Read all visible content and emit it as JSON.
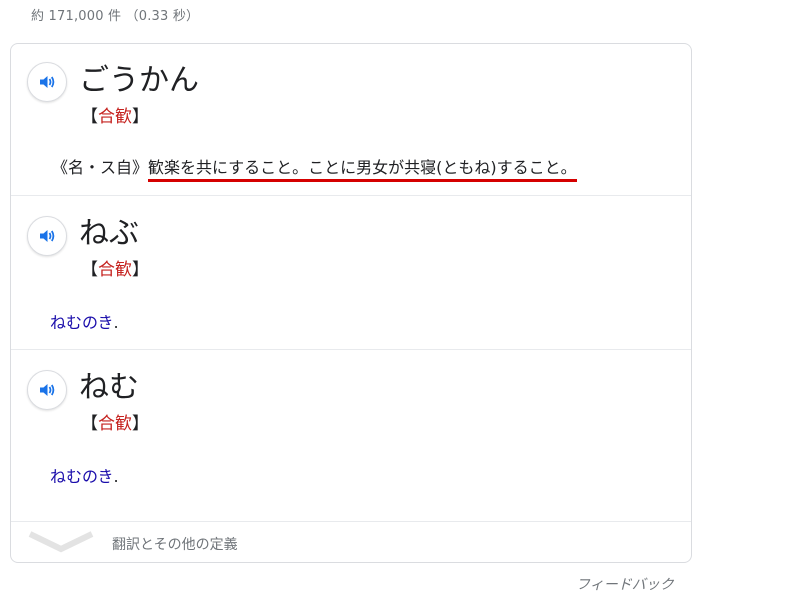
{
  "stats": {
    "text": "約 171,000 件 （0.33 秒）"
  },
  "entries": [
    {
      "word": "ごうかん",
      "kanji_open": "【",
      "kanji": "合歓",
      "kanji_close": "】",
      "pos": "《名・ス自》",
      "definition": "歓楽を共にすること。ことに男女が共寝(ともね)すること。"
    },
    {
      "word": "ねぶ",
      "kanji_open": "【",
      "kanji": "合歓",
      "kanji_close": "】",
      "link": "ねむのき",
      "link_suffix": "."
    },
    {
      "word": "ねむ",
      "kanji_open": "【",
      "kanji": "合歓",
      "kanji_close": "】",
      "link": "ねむのき",
      "link_suffix": "."
    }
  ],
  "more": {
    "label": "翻訳とその他の定義",
    "icon": "chevron-down-icon"
  },
  "feedback": {
    "label": "フィードバック"
  },
  "colors": {
    "kanji": "#c5221f",
    "link": "#1a0dab",
    "underline": "#d50000",
    "speaker_icon": "#1a73e8",
    "muted": "#70757a",
    "border": "#dadce0"
  },
  "icons": {
    "speaker": "speaker-icon"
  }
}
